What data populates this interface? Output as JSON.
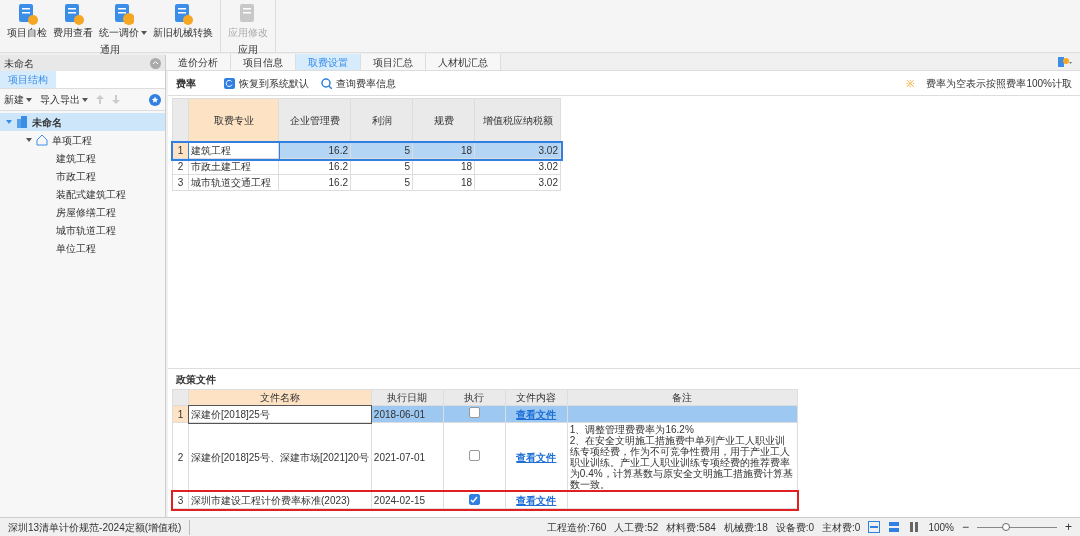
{
  "ribbon": {
    "groups": [
      {
        "label": "通用",
        "buttons": [
          {
            "label": "项目自检",
            "kind": "check",
            "disabled": false,
            "dropdown": false
          },
          {
            "label": "费用查看",
            "kind": "plus",
            "disabled": false,
            "dropdown": false
          },
          {
            "label": "统一调价",
            "kind": "coin",
            "disabled": false,
            "dropdown": true
          },
          {
            "label": "新旧机械转换",
            "kind": "machine",
            "disabled": false,
            "dropdown": false
          }
        ]
      },
      {
        "label": "应用",
        "buttons": [
          {
            "label": "应用修改",
            "kind": "doc",
            "disabled": true,
            "dropdown": false
          }
        ]
      }
    ]
  },
  "sidebar": {
    "title": "未命名",
    "tabs": [
      {
        "label": "项目结构",
        "selected": true
      }
    ],
    "toolbar": [
      {
        "label": "新建",
        "dropdown": true
      },
      {
        "label": "导入导出",
        "dropdown": true
      }
    ],
    "tree": [
      {
        "label": "未命名",
        "kind": "project",
        "expanded": true,
        "selected": true,
        "children": [
          {
            "label": "单项工程",
            "kind": "item",
            "expanded": true,
            "selected": false,
            "children": [
              {
                "label": "建筑工程",
                "selected": false
              },
              {
                "label": "市政工程",
                "selected": false
              },
              {
                "label": "装配式建筑工程",
                "selected": false
              },
              {
                "label": "房屋修缮工程",
                "selected": false
              },
              {
                "label": "城市轨道工程",
                "selected": false
              },
              {
                "label": "单位工程",
                "selected": false
              }
            ]
          }
        ]
      }
    ]
  },
  "tabs": [
    {
      "label": "造价分析",
      "selected": false
    },
    {
      "label": "项目信息",
      "selected": false
    },
    {
      "label": "取费设置",
      "selected": true
    },
    {
      "label": "项目汇总",
      "selected": false
    },
    {
      "label": "人材机汇总",
      "selected": false
    }
  ],
  "fee_rates": {
    "title": "费率",
    "actions": [
      {
        "label": "恢复到系统默认",
        "kind": "restore"
      },
      {
        "label": "查询费率信息",
        "kind": "search"
      }
    ],
    "note_mark": "※",
    "note": "费率为空表示按照费率100%计取",
    "table": {
      "columns": [
        "取费专业",
        "企业管理费",
        "利润",
        "规费",
        "增值税应纳税额"
      ],
      "rows": [
        {
          "index": "1",
          "selected": true,
          "cells": [
            "建筑工程",
            "16.2",
            "5",
            "18",
            "3.02"
          ]
        },
        {
          "index": "2",
          "selected": false,
          "cells": [
            "市政土建工程",
            "16.2",
            "5",
            "18",
            "3.02"
          ]
        },
        {
          "index": "3",
          "selected": false,
          "cells": [
            "城市轨道交通工程",
            "16.2",
            "5",
            "18",
            "3.02"
          ]
        }
      ]
    }
  },
  "policy_files": {
    "title": "政策文件",
    "columns": [
      "文件名称",
      "执行日期",
      "执行",
      "文件内容",
      "备注"
    ],
    "rows": [
      {
        "index": "1",
        "selected": true,
        "highlighted": false,
        "name": "深建价[2018]25号",
        "date": "2018-06-01",
        "checked": false,
        "link": "查看文件",
        "notes": []
      },
      {
        "index": "2",
        "selected": false,
        "highlighted": false,
        "name": "深建价[2018]25号、深建市场[2021]20号",
        "date": "2021-07-01",
        "checked": false,
        "link": "查看文件",
        "notes": [
          "1、调整管理费费率为16.2%",
          "2、在安全文明施工措施费中单列产业工人职业训练专项经费，作为不可竞争性费用，用于产业工人职业训练。产业工人职业训练专项经费的推荐费率为0.4%，计算基数与原安全文明施工措施费计算基数一致。"
        ]
      },
      {
        "index": "3",
        "selected": false,
        "highlighted": true,
        "name": "深圳市建设工程计价费率标准(2023)",
        "date": "2024-02-15",
        "checked": true,
        "link": "查看文件",
        "notes": []
      }
    ]
  },
  "status_bar": {
    "left": "深圳13清单计价规范-2024定额(增值税)",
    "stats": [
      "工程造价:760",
      "人工费:52",
      "材料费:584",
      "机械费:18",
      "设备费:0",
      "主材费:0"
    ],
    "zoom": "100%",
    "zoom_minus": "−",
    "zoom_plus": "+",
    "zoom_slider": {
      "level": 0.36
    }
  }
}
